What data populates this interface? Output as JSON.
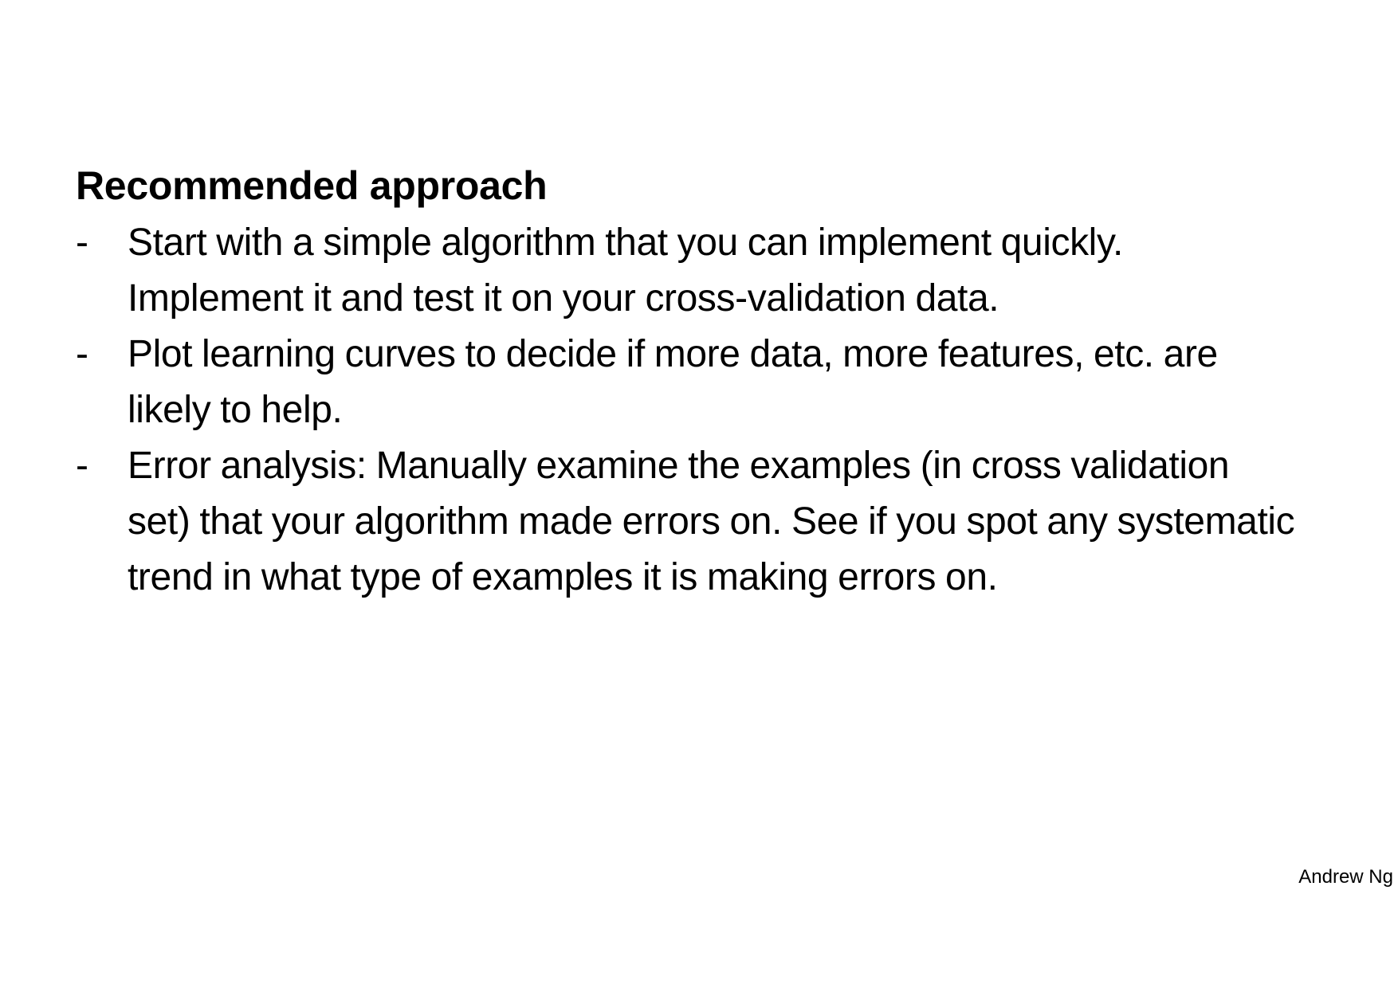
{
  "slide": {
    "title": "Recommended approach",
    "bullets": [
      {
        "marker": "-",
        "text": "Start with a simple algorithm that you can implement quickly. Implement it and test it on your cross-validation data."
      },
      {
        "marker": "-",
        "text": "Plot learning curves to decide if more data, more features, etc. are likely to help."
      },
      {
        "marker": "-",
        "text": "Error analysis:  Manually examine the examples (in cross validation set) that your algorithm made errors on. See if you spot any systematic trend in what type of examples it is making errors on."
      }
    ],
    "footer": "Andrew Ng"
  }
}
